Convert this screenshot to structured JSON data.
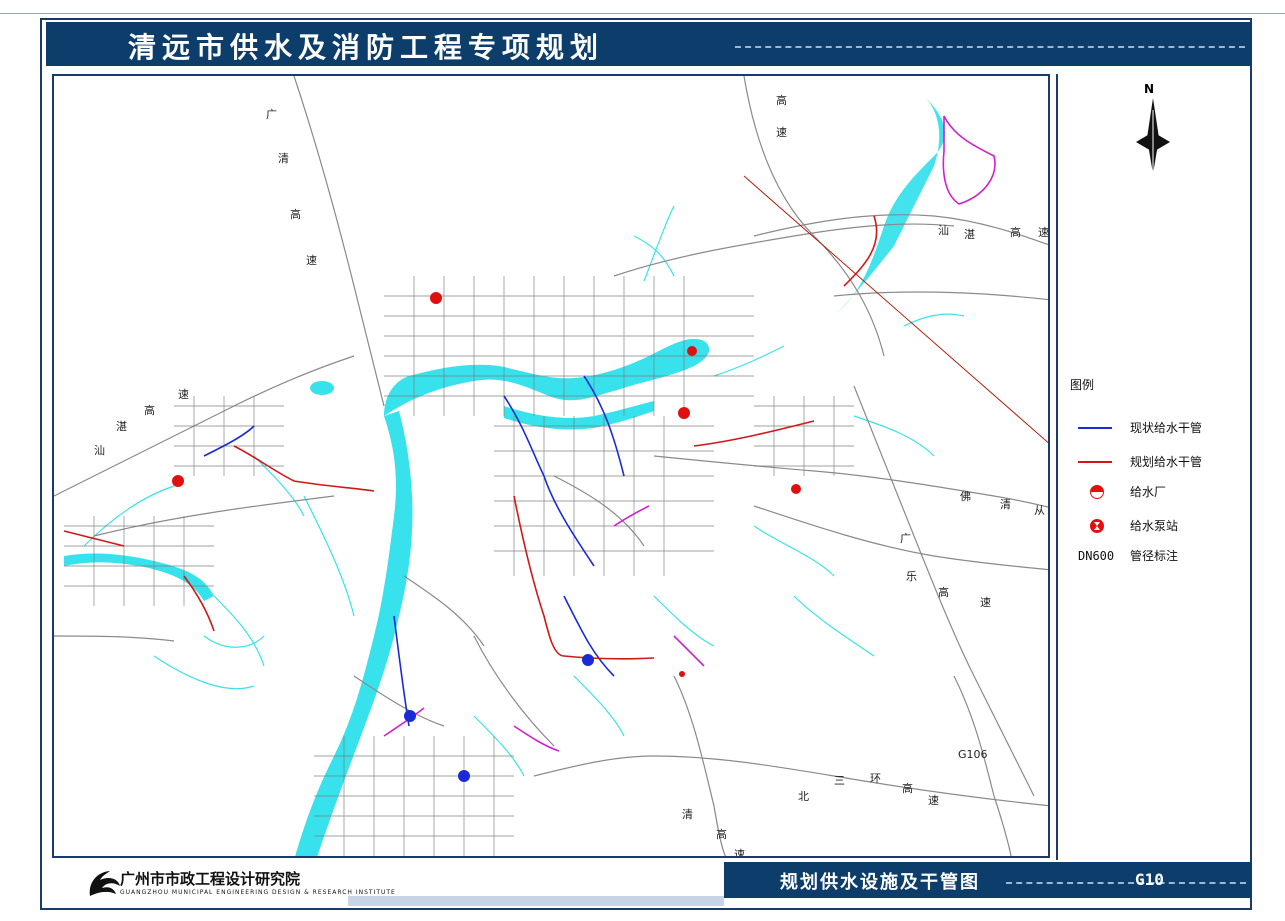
{
  "title": "清远市供水及消防工程专项规划",
  "plan_name": "规划供水设施及干管图",
  "drawing_no": "G10",
  "organization": {
    "name_cn": "广州市市政工程设计研究院",
    "name_en": "GUANGZHOU MUNICIPAL ENGINEERING DESIGN & RESEARCH INSTITUTE"
  },
  "north_label": "N",
  "legend": {
    "title": "图例",
    "items": [
      {
        "symbol": "blue-line",
        "color": "#1a2bd6",
        "label": "现状给水干管"
      },
      {
        "symbol": "red-line",
        "color": "#d01818",
        "label": "规划给水干管"
      },
      {
        "symbol": "water-plant",
        "color": "#e01010",
        "label": "给水厂"
      },
      {
        "symbol": "pump-station",
        "color": "#e01010",
        "label": "给水泵站"
      },
      {
        "symbol": "dn-code",
        "code": "DN600",
        "label": "管径标注"
      }
    ]
  },
  "map_labels": {
    "guangqing_expressway": [
      "广",
      "清",
      "高",
      "速"
    ],
    "shanzhan_left": [
      "汕",
      "湛",
      "高",
      "速"
    ],
    "shanzhan_top": [
      "汕",
      "湛",
      "高",
      "速"
    ],
    "gaosu_top": [
      "高",
      "速"
    ],
    "fuqing_cong": [
      "佛",
      "清",
      "从"
    ],
    "guangle_expressway": [
      "广",
      "乐",
      "高",
      "速"
    ],
    "beisanhuan": [
      "北",
      "三",
      "环",
      "高",
      "速"
    ],
    "qing_gaosu": [
      "清",
      "高",
      "速"
    ],
    "g106": "G106"
  },
  "colors": {
    "frame": "#1a3a6e",
    "title_bar": "#0c3d6b",
    "river": "#38e2ec",
    "road": "#8a8a8a",
    "existing_pipe": "#1a2bd6",
    "planned_pipe": "#d01818",
    "magenta_pipe": "#d020d0"
  }
}
